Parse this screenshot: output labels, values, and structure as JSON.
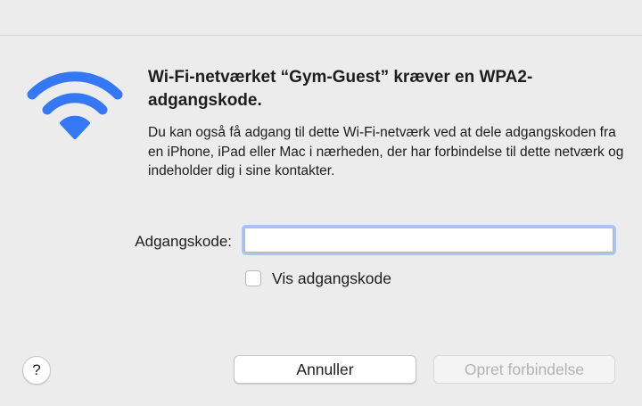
{
  "dialog": {
    "icon": "wifi-icon",
    "accent_color": "#3478f6",
    "headline": "Wi-Fi-netværket “Gym-Guest” kræver en WPA2-adgangskode.",
    "body": "Du kan også få adgang til dette Wi-Fi-netværk ved at dele adgangskoden fra en iPhone, iPad eller Mac i nærheden, der har forbindelse til dette netværk og indeholder dig i sine kontakter."
  },
  "password": {
    "label": "Adgangskode:",
    "value": "",
    "placeholder": ""
  },
  "show_password": {
    "label": "Vis adgangskode",
    "checked": false
  },
  "buttons": {
    "help": "?",
    "cancel": "Annuller",
    "connect": "Opret forbindelse",
    "connect_enabled": false
  }
}
